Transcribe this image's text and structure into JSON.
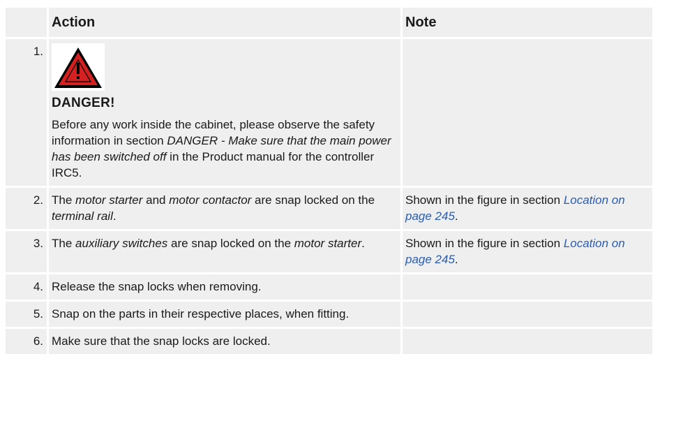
{
  "headers": {
    "action": "Action",
    "note": "Note"
  },
  "colors": {
    "cell_bg": "#efefef",
    "link": "#2a5db0",
    "warning_red": "#d42020"
  },
  "steps": [
    {
      "num": "1.",
      "icon": "danger-warning-triangle-icon",
      "danger_title": "DANGER!",
      "text_a": "Before any work inside the cabinet, please observe the safety information in section ",
      "text_i": "DANGER - Make sure that the main power has been switched off",
      "text_b": " in the Product manual for the controller IRC5."
    },
    {
      "num": "2.",
      "a1": "The ",
      "i1": "motor starter",
      "a2": " and ",
      "i2": "motor contactor",
      "a3": " are snap locked on the ",
      "i3": "terminal rail",
      "a4": ".",
      "note_text": "Shown in the figure in section ",
      "note_link": "Location on page 245",
      "note_end": "."
    },
    {
      "num": "3.",
      "a1": "The ",
      "i1": "auxiliary switches",
      "a2": " are snap locked on the ",
      "i2": "motor starter",
      "a3": ".",
      "note_text": "Shown in the figure in section ",
      "note_link": "Location on page 245",
      "note_end": "."
    },
    {
      "num": "4.",
      "text": "Release the snap locks when removing."
    },
    {
      "num": "5.",
      "text": "Snap on the parts in their respective places, when fitting."
    },
    {
      "num": "6.",
      "text": "Make sure that the snap locks are locked."
    }
  ]
}
